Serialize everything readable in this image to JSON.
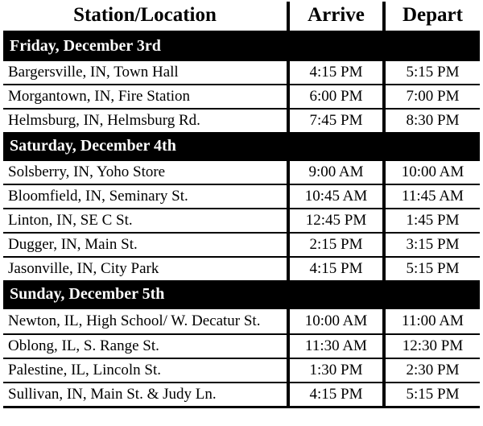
{
  "table": {
    "headers": {
      "station": "Station/Location",
      "arrive": "Arrive",
      "depart": "Depart"
    },
    "rows": [
      {
        "type": "date",
        "label": "Friday, December 3rd"
      },
      {
        "type": "stop",
        "station": "Bargersville, IN, Town Hall",
        "arrive": "4:15 PM",
        "depart": "5:15 PM"
      },
      {
        "type": "stop",
        "station": "Morgantown, IN, Fire Station",
        "arrive": "6:00 PM",
        "depart": "7:00 PM"
      },
      {
        "type": "stop",
        "station": "Helmsburg, IN, Helmsburg Rd.",
        "arrive": "7:45 PM",
        "depart": "8:30 PM"
      },
      {
        "type": "date",
        "label": "Saturday, December 4th"
      },
      {
        "type": "stop",
        "station": "Solsberry, IN, Yoho Store",
        "arrive": "9:00 AM",
        "depart": "10:00 AM"
      },
      {
        "type": "stop",
        "station": "Bloomfield, IN, Seminary St.",
        "arrive": "10:45 AM",
        "depart": "11:45 AM"
      },
      {
        "type": "stop",
        "station": "Linton, IN, SE C St.",
        "arrive": "12:45 PM",
        "depart": "1:45 PM"
      },
      {
        "type": "stop",
        "station": "Dugger, IN, Main St.",
        "arrive": "2:15 PM",
        "depart": "3:15 PM"
      },
      {
        "type": "stop",
        "station": "Jasonville, IN, City Park",
        "arrive": "4:15 PM",
        "depart": "5:15 PM"
      },
      {
        "type": "date",
        "label": "Sunday, December 5th"
      },
      {
        "type": "stop",
        "station": "Newton, IL, High School/ W. Decatur St.",
        "arrive": "10:00 AM",
        "depart": "11:00 AM",
        "tall": true
      },
      {
        "type": "stop",
        "station": "Oblong, IL, S. Range St.",
        "arrive": "11:30 AM",
        "depart": "12:30 PM"
      },
      {
        "type": "stop",
        "station": "Palestine, IL, Lincoln St.",
        "arrive": "1:30 PM",
        "depart": "2:30 PM"
      },
      {
        "type": "stop",
        "station": "Sullivan, IN, Main St. & Judy Ln.",
        "arrive": "4:15 PM",
        "depart": "5:15 PM"
      }
    ]
  }
}
